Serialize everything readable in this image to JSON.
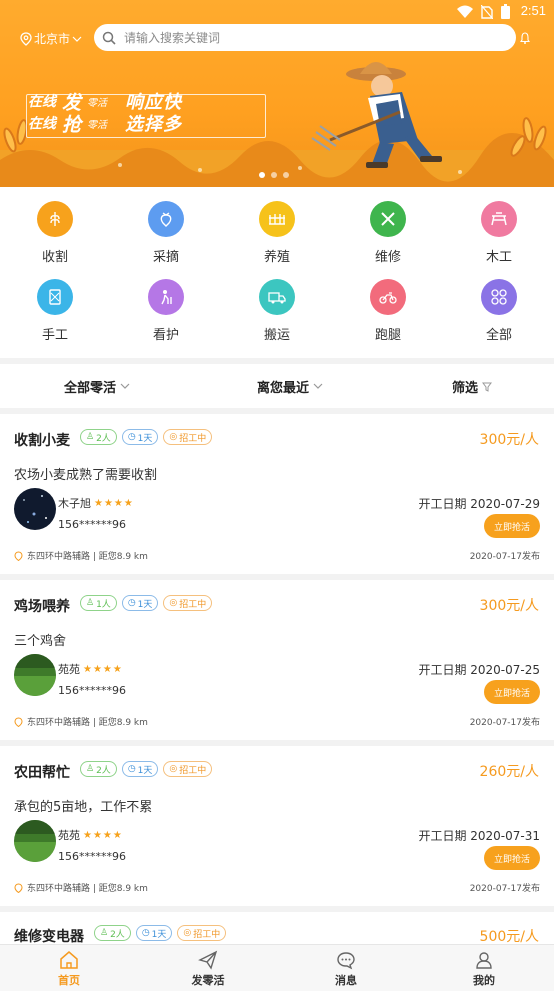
{
  "status_bar": {
    "time": "2:51"
  },
  "header": {
    "city": "北京市",
    "search_placeholder": "请输入搜索关键词"
  },
  "banner": {
    "line1_prefix": "在线",
    "line1_big": "发",
    "line1_suffix": "零活",
    "line1_right": "响应快",
    "line2_prefix": "在线",
    "line2_big": "抢",
    "line2_suffix": "零活",
    "line2_right": "选择多",
    "slide_count": 3,
    "active_slide": 1
  },
  "categories": [
    {
      "label": "收割",
      "icon": "wheat-icon",
      "color": "#f7a21c"
    },
    {
      "label": "采摘",
      "icon": "strawberry-icon",
      "color": "#5d9cf0"
    },
    {
      "label": "养殖",
      "icon": "farm-fence-icon",
      "color": "#f6c21a"
    },
    {
      "label": "维修",
      "icon": "tools-icon",
      "color": "#3fb54d"
    },
    {
      "label": "木工",
      "icon": "saw-table-icon",
      "color": "#f07aa0"
    },
    {
      "label": "手工",
      "icon": "craft-icon",
      "color": "#3bb5e8"
    },
    {
      "label": "看护",
      "icon": "caregiver-icon",
      "color": "#b577e6"
    },
    {
      "label": "搬运",
      "icon": "truck-icon",
      "color": "#3cc6c0"
    },
    {
      "label": "跑腿",
      "icon": "motorbike-icon",
      "color": "#f26b7c"
    },
    {
      "label": "全部",
      "icon": "grid-all-icon",
      "color": "#8a73e6"
    }
  ],
  "filters": {
    "all": "全部零活",
    "nearest": "离您最近",
    "screen": "筛选"
  },
  "jobs": [
    {
      "title": "收割小麦",
      "people": "2人",
      "days": "1天",
      "status": "招工中",
      "price": "300元/人",
      "desc": "农场小麦成熟了需要收割",
      "name": "木子旭",
      "stars": "★★★★",
      "phone": "156******96",
      "start": "开工日期 2020-07-29",
      "button": "立即抢活",
      "address": "东四环中路辅路 | 距您8.9 km",
      "published": "2020-07-17发布"
    },
    {
      "title": "鸡场喂养",
      "people": "1人",
      "days": "1天",
      "status": "招工中",
      "price": "300元/人",
      "desc": "三个鸡舍",
      "name": "苑苑",
      "stars": "★★★★",
      "phone": "156******96",
      "start": "开工日期 2020-07-25",
      "button": "立即抢活",
      "address": "东四环中路辅路 | 距您8.9 km",
      "published": "2020-07-17发布"
    },
    {
      "title": "农田帮忙",
      "people": "2人",
      "days": "1天",
      "status": "招工中",
      "price": "260元/人",
      "desc": "承包的5亩地，工作不累",
      "name": "苑苑",
      "stars": "★★★★",
      "phone": "156******96",
      "start": "开工日期 2020-07-31",
      "button": "立即抢活",
      "address": "东四环中路辅路 | 距您8.9 km",
      "published": "2020-07-17发布"
    },
    {
      "title": "维修变电器",
      "people": "2人",
      "days": "1天",
      "status": "招工中",
      "price": "500元/人"
    }
  ],
  "bottom_nav": [
    {
      "label": "首页",
      "icon": "home-icon",
      "active": true
    },
    {
      "label": "发零活",
      "icon": "paper-plane-icon",
      "active": false
    },
    {
      "label": "消息",
      "icon": "chat-bubble-icon",
      "active": false
    },
    {
      "label": "我的",
      "icon": "user-icon",
      "active": false
    }
  ],
  "colors": {
    "accent": "#f59a1f",
    "banner": "#ffa020"
  }
}
